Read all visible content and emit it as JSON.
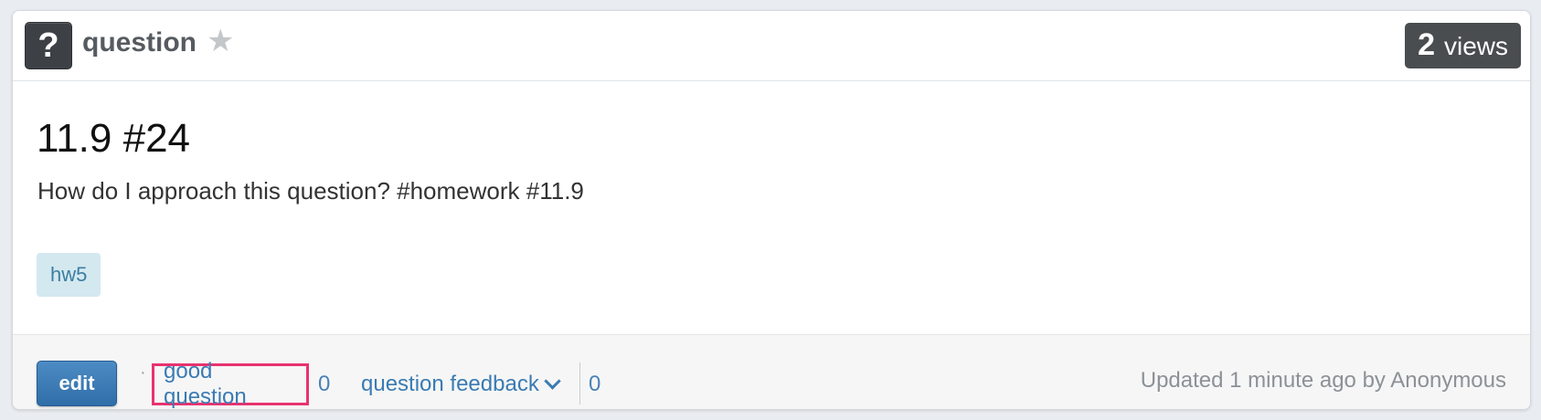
{
  "header": {
    "type_icon_glyph": "?",
    "type_label": "question",
    "star_glyph": "★",
    "views_count": "2",
    "views_label": "views"
  },
  "post": {
    "title": "11.9 #24",
    "content": "How do I approach this question? #homework #11.9",
    "tags": [
      "hw5"
    ]
  },
  "footer": {
    "edit_label": "edit",
    "separator": "·",
    "good_question_label": "good question",
    "good_question_count": "0",
    "feedback_label": "question feedback",
    "feedback_count": "0",
    "updated_text": "Updated 1 minute ago by Anonymous"
  },
  "colors": {
    "highlight_border": "#e8336f",
    "link": "#3a7bb3",
    "edit_button": "#3a78b2",
    "tag_bg": "#d4e8f0",
    "badge_bg": "#4a4d50"
  },
  "icons": {
    "type": "question-mark-icon",
    "favorite": "star-icon",
    "dropdown": "chevron-down-icon"
  }
}
